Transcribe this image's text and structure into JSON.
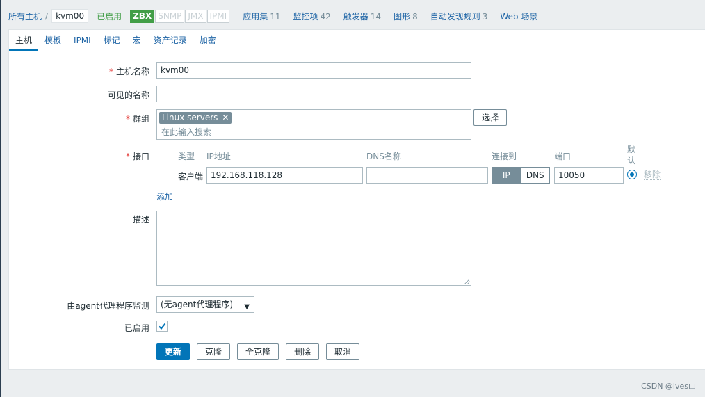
{
  "breadcrumb": {
    "all_hosts": "所有主机",
    "separator": "/",
    "current_host": "kvm00"
  },
  "status": "已启用",
  "availability": [
    "ZBX",
    "SNMP",
    "JMX",
    "IPMI"
  ],
  "nav": [
    {
      "label": "应用集",
      "count": "11"
    },
    {
      "label": "监控项",
      "count": "42"
    },
    {
      "label": "触发器",
      "count": "14"
    },
    {
      "label": "图形",
      "count": "8"
    },
    {
      "label": "自动发现规则",
      "count": "3"
    },
    {
      "label": "Web 场景",
      "count": ""
    }
  ],
  "tabs": [
    "主机",
    "模板",
    "IPMI",
    "标记",
    "宏",
    "资产记录",
    "加密"
  ],
  "form": {
    "hostname": {
      "label": "主机名称",
      "value": "kvm00"
    },
    "visible_name": {
      "label": "可见的名称",
      "value": ""
    },
    "groups": {
      "label": "群组",
      "chip": "Linux servers",
      "placeholder": "在此输入搜索",
      "select_button": "选择"
    },
    "interfaces": {
      "label": "接口",
      "headers": {
        "type": "类型",
        "ip": "IP地址",
        "dns": "DNS名称",
        "connect": "连接到",
        "port": "端口",
        "default": "默认"
      },
      "row": {
        "type": "客户端",
        "ip": "192.168.118.128",
        "dns": "",
        "connect_ip": "IP",
        "connect_dns": "DNS",
        "port": "10050",
        "remove": "移除"
      },
      "add": "添加"
    },
    "description": {
      "label": "描述",
      "value": ""
    },
    "proxy": {
      "label": "由agent代理程序监测",
      "value": "(无agent代理程序)"
    },
    "enabled": {
      "label": "已启用",
      "checked": true
    }
  },
  "buttons": {
    "update": "更新",
    "clone": "克隆",
    "full_clone": "全克隆",
    "delete": "删除",
    "cancel": "取消"
  },
  "watermark": "CSDN @ives山"
}
